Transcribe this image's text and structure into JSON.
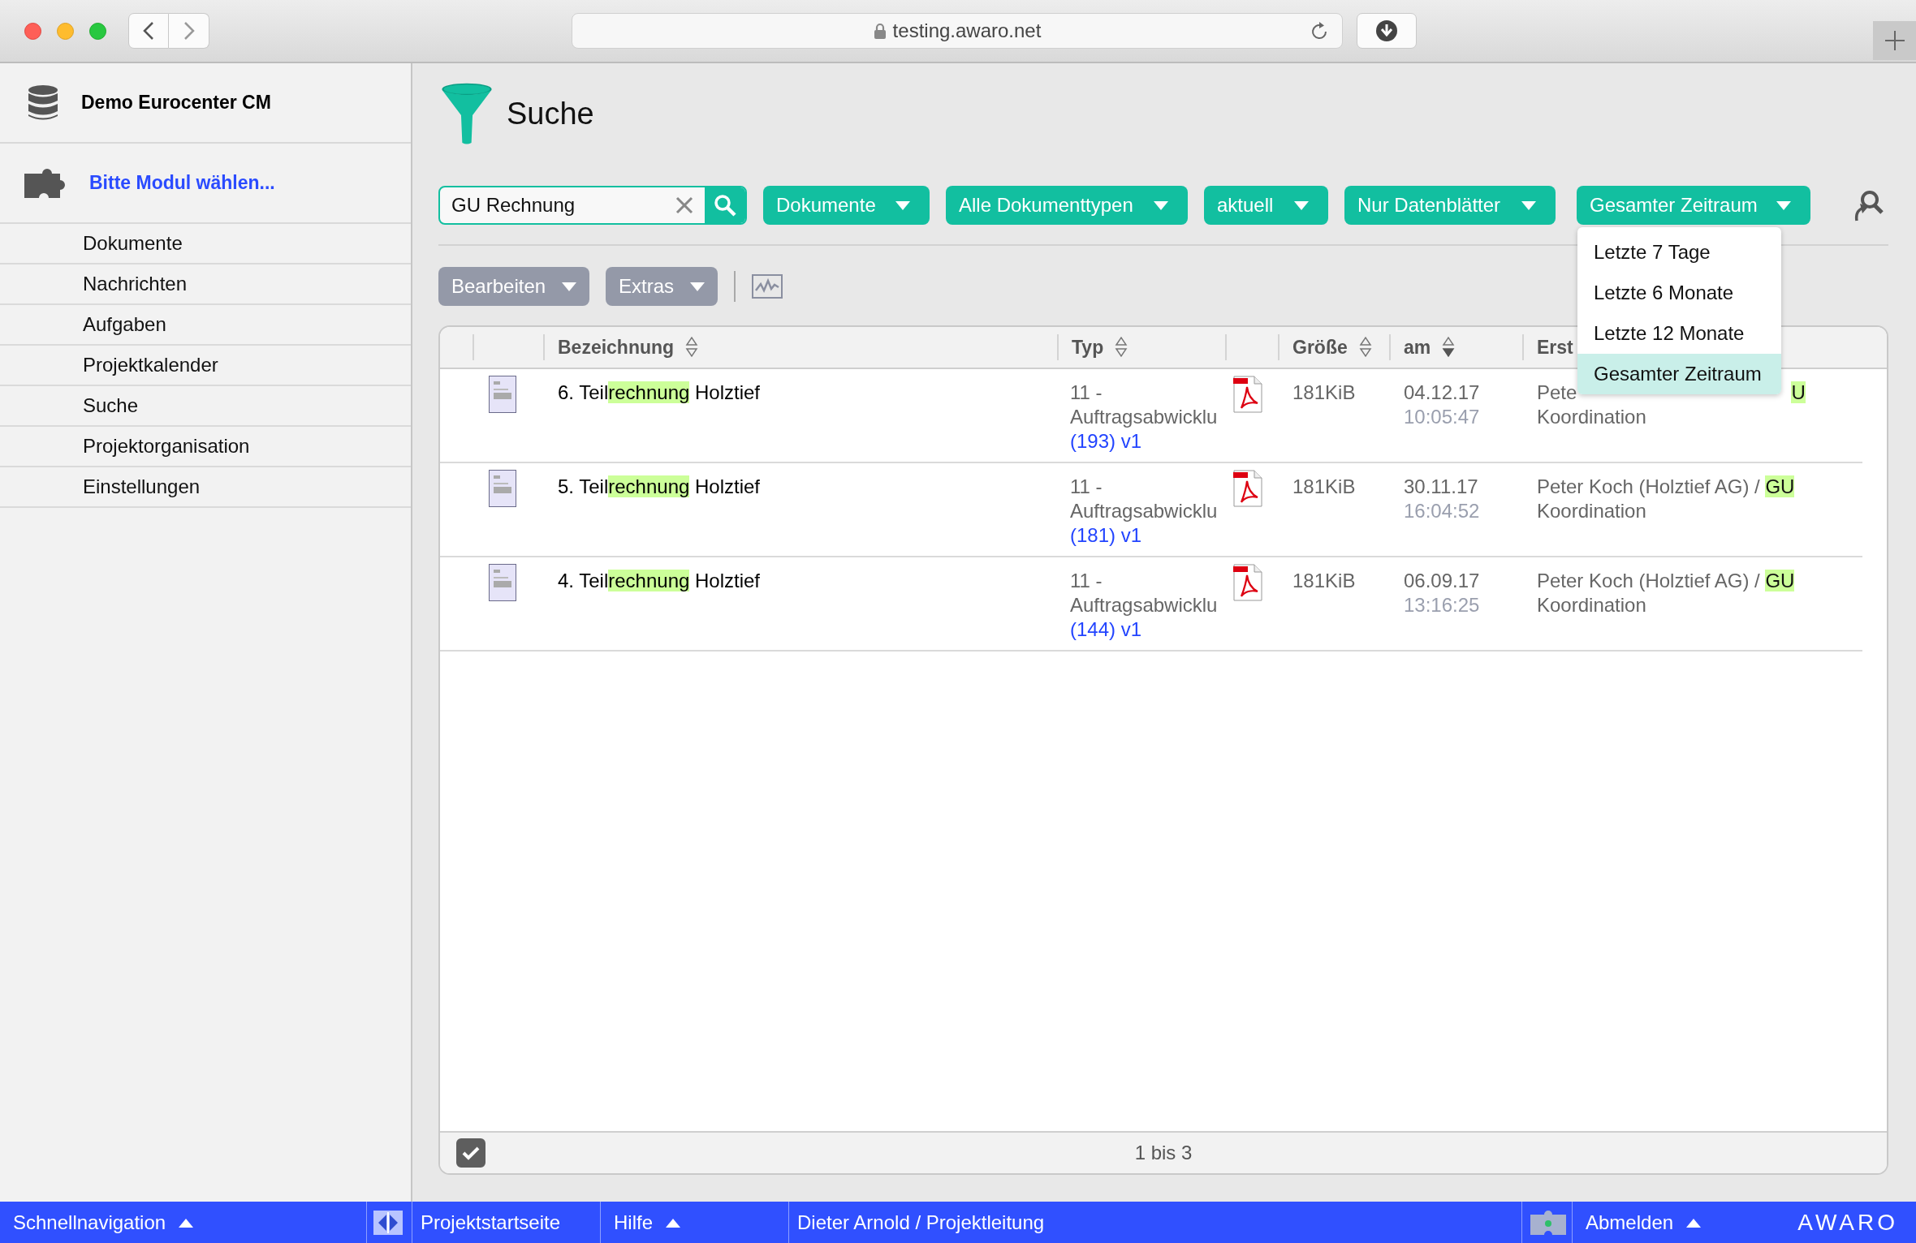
{
  "browser": {
    "url": "testing.awaro.net"
  },
  "sidebar": {
    "project": "Demo Eurocenter CM",
    "module": "Bitte Modul wählen...",
    "items": [
      {
        "label": "Dokumente"
      },
      {
        "label": "Nachrichten"
      },
      {
        "label": "Aufgaben"
      },
      {
        "label": "Projektkalender"
      },
      {
        "label": "Suche"
      },
      {
        "label": "Projektorganisation"
      },
      {
        "label": "Einstellungen"
      }
    ]
  },
  "page": {
    "title": "Suche"
  },
  "search": {
    "value": "GU Rechnung"
  },
  "filters": [
    {
      "label": "Dokumente"
    },
    {
      "label": "Alle Dokumenttypen"
    },
    {
      "label": "aktuell"
    },
    {
      "label": "Nur Datenblätter"
    },
    {
      "label": "Gesamter Zeitraum",
      "menu": [
        {
          "label": "Letzte 7 Tage",
          "selected": false
        },
        {
          "label": "Letzte 6 Monate",
          "selected": false
        },
        {
          "label": "Letzte 12 Monate",
          "selected": false
        },
        {
          "label": "Gesamter Zeitraum",
          "selected": true
        }
      ]
    }
  ],
  "toolbar": {
    "buttons": [
      "Bearbeiten",
      "Extras"
    ]
  },
  "table": {
    "columns": [
      {
        "label": "Bezeichnung",
        "sorted": false
      },
      {
        "label": "Typ",
        "sorted": false
      },
      {
        "label": "Größe",
        "sorted": false
      },
      {
        "label": "am",
        "sorted": true
      },
      {
        "label": "Erst"
      }
    ],
    "rows": [
      {
        "title": "6. Teil**rechnung** Holztief",
        "type": "11 -",
        "type_line2": "Auftragsabwicklu",
        "ref": "(193) v1",
        "size": "181KiB",
        "date": "04.12.17",
        "time": "10:05:47",
        "creator": "Pete",
        "creator_end": "**U**",
        "creator_line2": "Koordination"
      },
      {
        "title": "5. Teil**rechnung** Holztief",
        "type": "11 -",
        "type_line2": "Auftragsabwicklu",
        "ref": "(181) v1",
        "size": "181KiB",
        "date": "30.11.17",
        "time": "16:04:52",
        "creator": "Peter Koch (Holztief AG) / **GU**",
        "creator_line2": "Koordination"
      },
      {
        "title": "4. Teil**rechnung** Holztief",
        "type": "11 -",
        "type_line2": "Auftragsabwicklu",
        "ref": "(144) v1",
        "size": "181KiB",
        "date": "06.09.17",
        "time": "13:16:25",
        "creator": "Peter Koch (Holztief AG) / **GU**",
        "creator_line2": "Koordination"
      }
    ],
    "select_all": {
      "checked": true
    },
    "footer": "1 bis 3"
  },
  "status_bar": {
    "quick_nav": "Schnellnavigation",
    "home": "Projektstartseite",
    "help": "Hilfe",
    "user": "Dieter Arnold / Projektleitung",
    "logout": "Abmelden",
    "logo": "AWARO"
  }
}
